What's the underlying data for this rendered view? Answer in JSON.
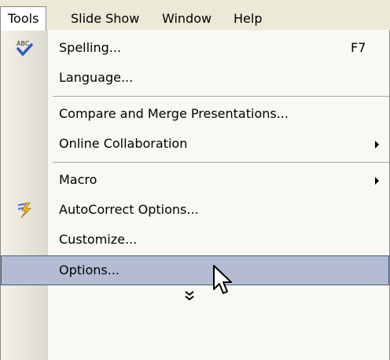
{
  "menubar": {
    "items": [
      {
        "label": "Tools",
        "active": true
      },
      {
        "label": "Slide Show",
        "active": false
      },
      {
        "label": "Window",
        "active": false
      },
      {
        "label": "Help",
        "active": false
      }
    ]
  },
  "menu": {
    "items": [
      {
        "label": "Spelling...",
        "shortcut": "F7",
        "icon": "spelling-icon"
      },
      {
        "label": "Language..."
      },
      {
        "label": "Compare and Merge Presentations..."
      },
      {
        "label": "Online Collaboration",
        "submenu": true
      },
      {
        "label": "Macro",
        "submenu": true
      },
      {
        "label": "AutoCorrect Options...",
        "icon": "autocorrect-icon"
      },
      {
        "label": "Customize..."
      },
      {
        "label": "Options...",
        "selected": true
      }
    ],
    "expand_icon": "double-chevron-down-icon"
  },
  "colors": {
    "menubar_bg": "#ece9d8",
    "menu_bg": "#f9f8f3",
    "selection_bg": "#b3bcd2",
    "selection_border": "#4a5a80"
  }
}
